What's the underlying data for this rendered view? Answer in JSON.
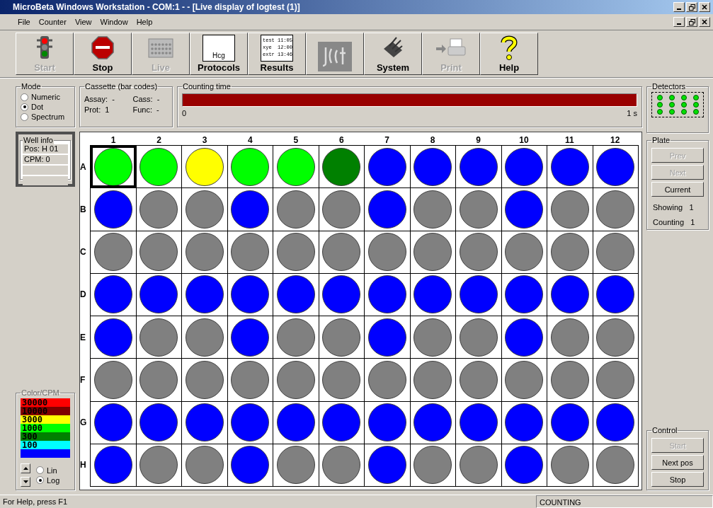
{
  "window": {
    "title": "MicroBeta Windows Workstation - COM:1 -  - [Live display of logtest (1)]"
  },
  "menu": [
    "File",
    "Counter",
    "View",
    "Window",
    "Help"
  ],
  "toolbar": [
    {
      "kind": "traffic-light",
      "label": "Start",
      "disabled": true
    },
    {
      "kind": "stop-sign",
      "label": "Stop",
      "disabled": false
    },
    {
      "kind": "plate-grid",
      "label": "Live",
      "disabled": true
    },
    {
      "kind": "checklist",
      "label": "Protocols",
      "disabled": false,
      "icon_lines": [
        "Hcg"
      ]
    },
    {
      "kind": "results-sheet",
      "label": "Results",
      "disabled": false,
      "icon_lines": [
        "test 11:05",
        "xye  12:00",
        "extr 13:46"
      ]
    },
    {
      "kind": "logo"
    },
    {
      "kind": "tool",
      "label": "System",
      "disabled": false
    },
    {
      "kind": "printer",
      "label": "Print",
      "disabled": true
    },
    {
      "kind": "question",
      "label": "Help",
      "disabled": false
    }
  ],
  "mode": {
    "title": "Mode",
    "options": [
      {
        "label": "Numeric",
        "selected": false
      },
      {
        "label": "Dot",
        "selected": true
      },
      {
        "label": "Spectrum",
        "selected": false
      }
    ]
  },
  "cassette": {
    "title": "Cassette (bar codes)",
    "fields": [
      {
        "label": "Assay:",
        "value": "-"
      },
      {
        "label": "Cass:",
        "value": "-"
      },
      {
        "label": "Prot:",
        "value": "1"
      },
      {
        "label": "Func:",
        "value": "-"
      }
    ]
  },
  "counting_time": {
    "title": "Counting time",
    "level": 1,
    "min_label": "0",
    "max_label": "1 s"
  },
  "detectors": {
    "title": "Detectors",
    "dots": [
      {
        "on": true
      },
      {
        "on": true
      },
      {
        "on": true
      },
      {
        "on": true
      },
      {
        "on": true
      },
      {
        "on": true
      },
      {
        "on": true
      },
      {
        "on": true
      },
      {
        "on": true
      },
      {
        "on": true
      },
      {
        "on": true
      },
      {
        "on": true
      }
    ]
  },
  "well_info": {
    "title": "Well info",
    "lines": [
      "Pos: H 01",
      "CPM: 0"
    ]
  },
  "plate": {
    "columns": [
      "1",
      "2",
      "3",
      "4",
      "5",
      "6",
      "7",
      "8",
      "9",
      "10",
      "11",
      "12"
    ],
    "rows": [
      {
        "label": "A",
        "wells": [
          {
            "color": "#00ff00",
            "selected": true
          },
          {
            "color": "#00ff00",
            "selected": false
          },
          {
            "color": "#ffff00",
            "selected": false
          },
          {
            "color": "#00ff00",
            "selected": false
          },
          {
            "color": "#00ff00",
            "selected": false
          },
          {
            "color": "#008000",
            "selected": false
          },
          {
            "color": "#0000ff",
            "selected": false
          },
          {
            "color": "#0000ff",
            "selected": false
          },
          {
            "color": "#0000ff",
            "selected": false
          },
          {
            "color": "#0000ff",
            "selected": false
          },
          {
            "color": "#0000ff",
            "selected": false
          },
          {
            "color": "#0000ff",
            "selected": false
          }
        ]
      },
      {
        "label": "B",
        "wells": [
          {
            "color": "#0000ff",
            "selected": false
          },
          {
            "color": "#808080",
            "selected": false
          },
          {
            "color": "#808080",
            "selected": false
          },
          {
            "color": "#0000ff",
            "selected": false
          },
          {
            "color": "#808080",
            "selected": false
          },
          {
            "color": "#808080",
            "selected": false
          },
          {
            "color": "#0000ff",
            "selected": false
          },
          {
            "color": "#808080",
            "selected": false
          },
          {
            "color": "#808080",
            "selected": false
          },
          {
            "color": "#0000ff",
            "selected": false
          },
          {
            "color": "#808080",
            "selected": false
          },
          {
            "color": "#808080",
            "selected": false
          }
        ]
      },
      {
        "label": "C",
        "wells": [
          {
            "color": "#808080",
            "selected": false
          },
          {
            "color": "#808080",
            "selected": false
          },
          {
            "color": "#808080",
            "selected": false
          },
          {
            "color": "#808080",
            "selected": false
          },
          {
            "color": "#808080",
            "selected": false
          },
          {
            "color": "#808080",
            "selected": false
          },
          {
            "color": "#808080",
            "selected": false
          },
          {
            "color": "#808080",
            "selected": false
          },
          {
            "color": "#808080",
            "selected": false
          },
          {
            "color": "#808080",
            "selected": false
          },
          {
            "color": "#808080",
            "selected": false
          },
          {
            "color": "#808080",
            "selected": false
          }
        ]
      },
      {
        "label": "D",
        "wells": [
          {
            "color": "#0000ff",
            "selected": false
          },
          {
            "color": "#0000ff",
            "selected": false
          },
          {
            "color": "#0000ff",
            "selected": false
          },
          {
            "color": "#0000ff",
            "selected": false
          },
          {
            "color": "#0000ff",
            "selected": false
          },
          {
            "color": "#0000ff",
            "selected": false
          },
          {
            "color": "#0000ff",
            "selected": false
          },
          {
            "color": "#0000ff",
            "selected": false
          },
          {
            "color": "#0000ff",
            "selected": false
          },
          {
            "color": "#0000ff",
            "selected": false
          },
          {
            "color": "#0000ff",
            "selected": false
          },
          {
            "color": "#0000ff",
            "selected": false
          }
        ]
      },
      {
        "label": "E",
        "wells": [
          {
            "color": "#0000ff",
            "selected": false
          },
          {
            "color": "#808080",
            "selected": false
          },
          {
            "color": "#808080",
            "selected": false
          },
          {
            "color": "#0000ff",
            "selected": false
          },
          {
            "color": "#808080",
            "selected": false
          },
          {
            "color": "#808080",
            "selected": false
          },
          {
            "color": "#0000ff",
            "selected": false
          },
          {
            "color": "#808080",
            "selected": false
          },
          {
            "color": "#808080",
            "selected": false
          },
          {
            "color": "#0000ff",
            "selected": false
          },
          {
            "color": "#808080",
            "selected": false
          },
          {
            "color": "#808080",
            "selected": false
          }
        ]
      },
      {
        "label": "F",
        "wells": [
          {
            "color": "#808080",
            "selected": false
          },
          {
            "color": "#808080",
            "selected": false
          },
          {
            "color": "#808080",
            "selected": false
          },
          {
            "color": "#808080",
            "selected": false
          },
          {
            "color": "#808080",
            "selected": false
          },
          {
            "color": "#808080",
            "selected": false
          },
          {
            "color": "#808080",
            "selected": false
          },
          {
            "color": "#808080",
            "selected": false
          },
          {
            "color": "#808080",
            "selected": false
          },
          {
            "color": "#808080",
            "selected": false
          },
          {
            "color": "#808080",
            "selected": false
          },
          {
            "color": "#808080",
            "selected": false
          }
        ]
      },
      {
        "label": "G",
        "wells": [
          {
            "color": "#0000ff",
            "selected": false
          },
          {
            "color": "#0000ff",
            "selected": false
          },
          {
            "color": "#0000ff",
            "selected": false
          },
          {
            "color": "#0000ff",
            "selected": false
          },
          {
            "color": "#0000ff",
            "selected": false
          },
          {
            "color": "#0000ff",
            "selected": false
          },
          {
            "color": "#0000ff",
            "selected": false
          },
          {
            "color": "#0000ff",
            "selected": false
          },
          {
            "color": "#0000ff",
            "selected": false
          },
          {
            "color": "#0000ff",
            "selected": false
          },
          {
            "color": "#0000ff",
            "selected": false
          },
          {
            "color": "#0000ff",
            "selected": false
          }
        ]
      },
      {
        "label": "H",
        "wells": [
          {
            "color": "#0000ff",
            "selected": false
          },
          {
            "color": "#808080",
            "selected": false
          },
          {
            "color": "#808080",
            "selected": false
          },
          {
            "color": "#0000ff",
            "selected": false
          },
          {
            "color": "#808080",
            "selected": false
          },
          {
            "color": "#808080",
            "selected": false
          },
          {
            "color": "#0000ff",
            "selected": false
          },
          {
            "color": "#808080",
            "selected": false
          },
          {
            "color": "#808080",
            "selected": false
          },
          {
            "color": "#0000ff",
            "selected": false
          },
          {
            "color": "#808080",
            "selected": false
          },
          {
            "color": "#808080",
            "selected": false
          }
        ]
      }
    ]
  },
  "plate_nav": {
    "title": "Plate",
    "buttons": [
      {
        "label": "Prev",
        "disabled": true
      },
      {
        "label": "Next",
        "disabled": true
      },
      {
        "label": "Current",
        "disabled": false
      }
    ],
    "stats": [
      {
        "label": "Showing",
        "value": "1"
      },
      {
        "label": "Counting",
        "value": "1"
      }
    ]
  },
  "color_scale": {
    "title": "Color/CPM",
    "bands": [
      {
        "label": "30000",
        "color": "#ff0000"
      },
      {
        "label": "10000",
        "color": "#800000"
      },
      {
        "label": "3000",
        "color": "#ffff00"
      },
      {
        "label": "1000",
        "color": "#00ff00"
      },
      {
        "label": "300",
        "color": "#008000"
      },
      {
        "label": "100",
        "color": "#00ffff"
      },
      {
        "color": "#0000ff"
      }
    ],
    "scale": [
      {
        "label": "Lin",
        "selected": false
      },
      {
        "label": "Log",
        "selected": true
      }
    ]
  },
  "control": {
    "title": "Control",
    "buttons": [
      {
        "label": "Start",
        "disabled": true
      },
      {
        "label": "Next pos",
        "disabled": false
      },
      {
        "label": "Stop",
        "disabled": false
      }
    ]
  },
  "status_bar": {
    "help": "For Help, press F1",
    "state": "COUNTING"
  }
}
